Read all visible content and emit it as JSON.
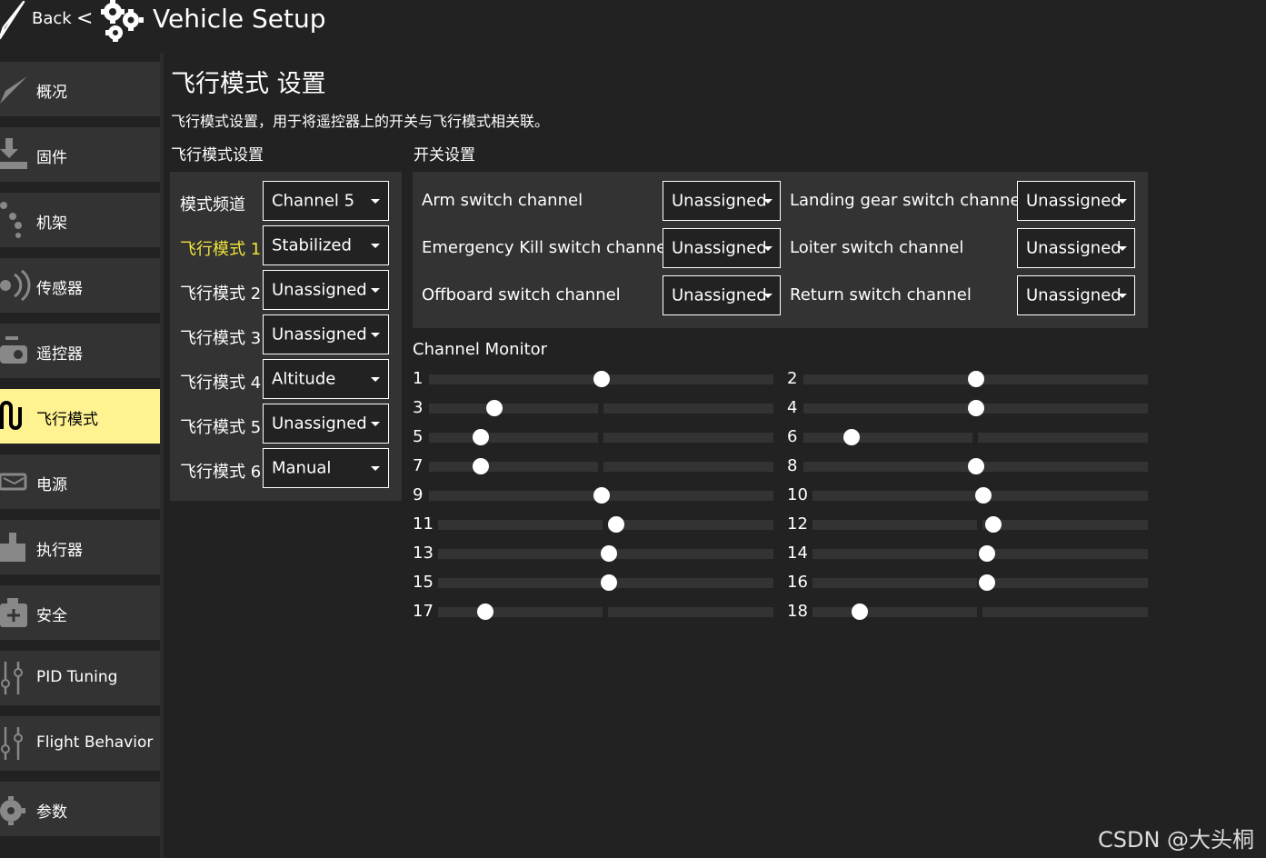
{
  "header": {
    "back_label": "Back",
    "back_chevron": "<",
    "title": "Vehicle Setup",
    "back_icon": "paper-plane-icon",
    "title_icon": "gears-icon"
  },
  "sidebar": {
    "items": [
      {
        "label": "概况",
        "icon": "paper-plane-icon",
        "active": false
      },
      {
        "label": "固件",
        "icon": "download-icon",
        "active": false
      },
      {
        "label": "机架",
        "icon": "airframe-icon",
        "active": false
      },
      {
        "label": "传感器",
        "icon": "sensor-icon",
        "active": false
      },
      {
        "label": "遥控器",
        "icon": "radio-controller-icon",
        "active": false
      },
      {
        "label": "飞行模式",
        "icon": "flight-modes-icon",
        "active": true
      },
      {
        "label": "电源",
        "icon": "power-icon",
        "active": false
      },
      {
        "label": "执行器",
        "icon": "actuator-icon",
        "active": false
      },
      {
        "label": "安全",
        "icon": "safety-icon",
        "active": false
      },
      {
        "label": "PID Tuning",
        "icon": "sliders-icon",
        "active": false
      },
      {
        "label": "Flight Behavior",
        "icon": "sliders-icon",
        "active": false
      },
      {
        "label": "参数",
        "icon": "gear-icon",
        "active": false
      }
    ]
  },
  "main": {
    "title": "飞行模式 设置",
    "description": "飞行模式设置，用于将遥控器上的开关与飞行模式相关联。",
    "flight_section_label": "飞行模式设置",
    "switch_section_label": "开关设置",
    "mode_channel": {
      "label": "模式频道",
      "value": "Channel 5"
    },
    "flight_modes": [
      {
        "label": "飞行模式 1",
        "value": "Stabilized",
        "active": true
      },
      {
        "label": "飞行模式 2",
        "value": "Unassigned",
        "active": false
      },
      {
        "label": "飞行模式 3",
        "value": "Unassigned",
        "active": false
      },
      {
        "label": "飞行模式 4",
        "value": "Altitude",
        "active": false
      },
      {
        "label": "飞行模式 5",
        "value": "Unassigned",
        "active": false
      },
      {
        "label": "飞行模式 6",
        "value": "Manual",
        "active": false
      }
    ],
    "switches": [
      {
        "label": "Arm switch channel",
        "value": "Unassigned"
      },
      {
        "label": "Landing gear switch channel",
        "value": "Unassigned"
      },
      {
        "label": "Emergency Kill switch channel",
        "value": "Unassigned"
      },
      {
        "label": "Loiter switch channel",
        "value": "Unassigned"
      },
      {
        "label": "Offboard switch channel",
        "value": "Unassigned"
      },
      {
        "label": "Return switch channel",
        "value": "Unassigned"
      }
    ],
    "channel_monitor": {
      "title": "Channel Monitor",
      "channels": [
        {
          "number": "1",
          "position": 0.5
        },
        {
          "number": "2",
          "position": 0.5
        },
        {
          "number": "3",
          "position": 0.19
        },
        {
          "number": "4",
          "position": 0.5
        },
        {
          "number": "5",
          "position": 0.15
        },
        {
          "number": "6",
          "position": 0.14
        },
        {
          "number": "7",
          "position": 0.15
        },
        {
          "number": "8",
          "position": 0.5
        },
        {
          "number": "9",
          "position": 0.5
        },
        {
          "number": "10",
          "position": 0.51
        },
        {
          "number": "11",
          "position": 0.53
        },
        {
          "number": "12",
          "position": 0.54
        },
        {
          "number": "13",
          "position": 0.51
        },
        {
          "number": "14",
          "position": 0.52
        },
        {
          "number": "15",
          "position": 0.51
        },
        {
          "number": "16",
          "position": 0.52
        },
        {
          "number": "17",
          "position": 0.14
        },
        {
          "number": "18",
          "position": 0.14
        }
      ]
    }
  },
  "watermark": "CSDN @大头桐",
  "colors": {
    "background": "#222222",
    "panel": "#333333",
    "active_item": "#fff291",
    "active_label": "#f1e33b",
    "text": "#ffffff"
  }
}
